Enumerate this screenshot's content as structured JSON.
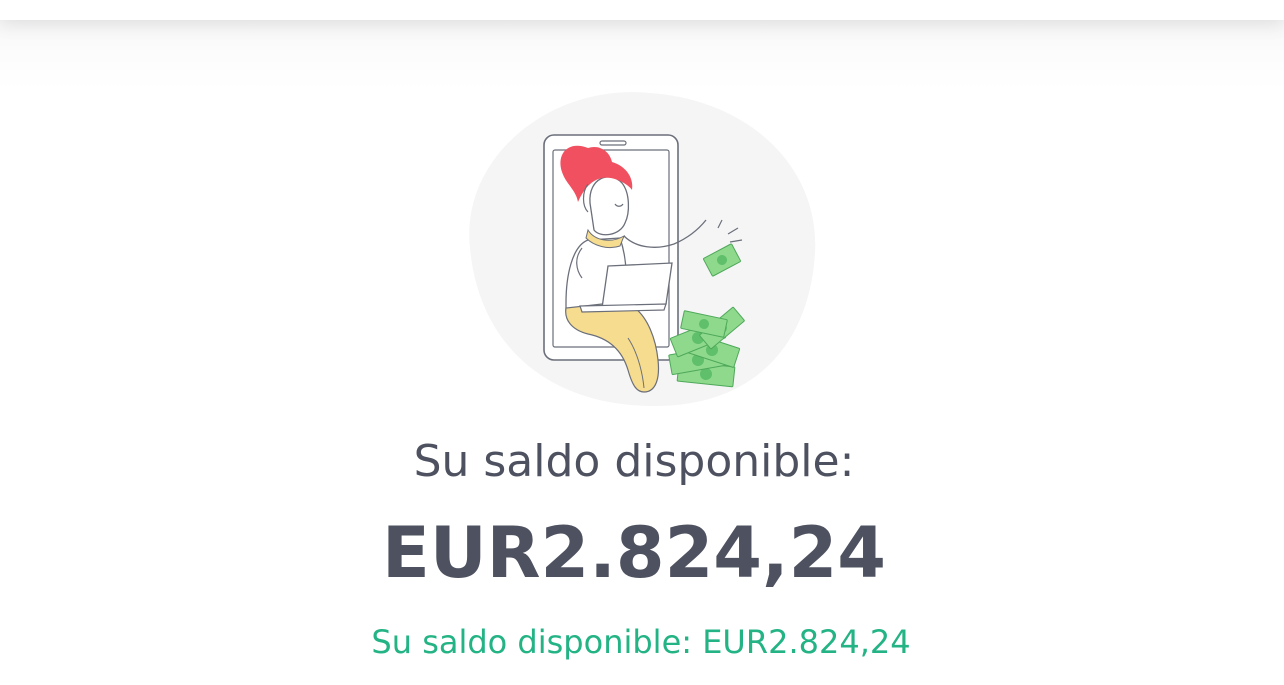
{
  "balance": {
    "label": "Su saldo disponible:",
    "amount": "EUR2.824,24",
    "summary": "Su saldo disponible: EUR2.824,24"
  },
  "illustration": {
    "icon": "person-with-laptop-and-money-illustration"
  },
  "colors": {
    "text": "#4e5260",
    "accent": "#23b384",
    "hair": "#f0505f",
    "pants": "#f6dc8f",
    "money": "#8ed98c",
    "blob": "#f5f5f6"
  }
}
